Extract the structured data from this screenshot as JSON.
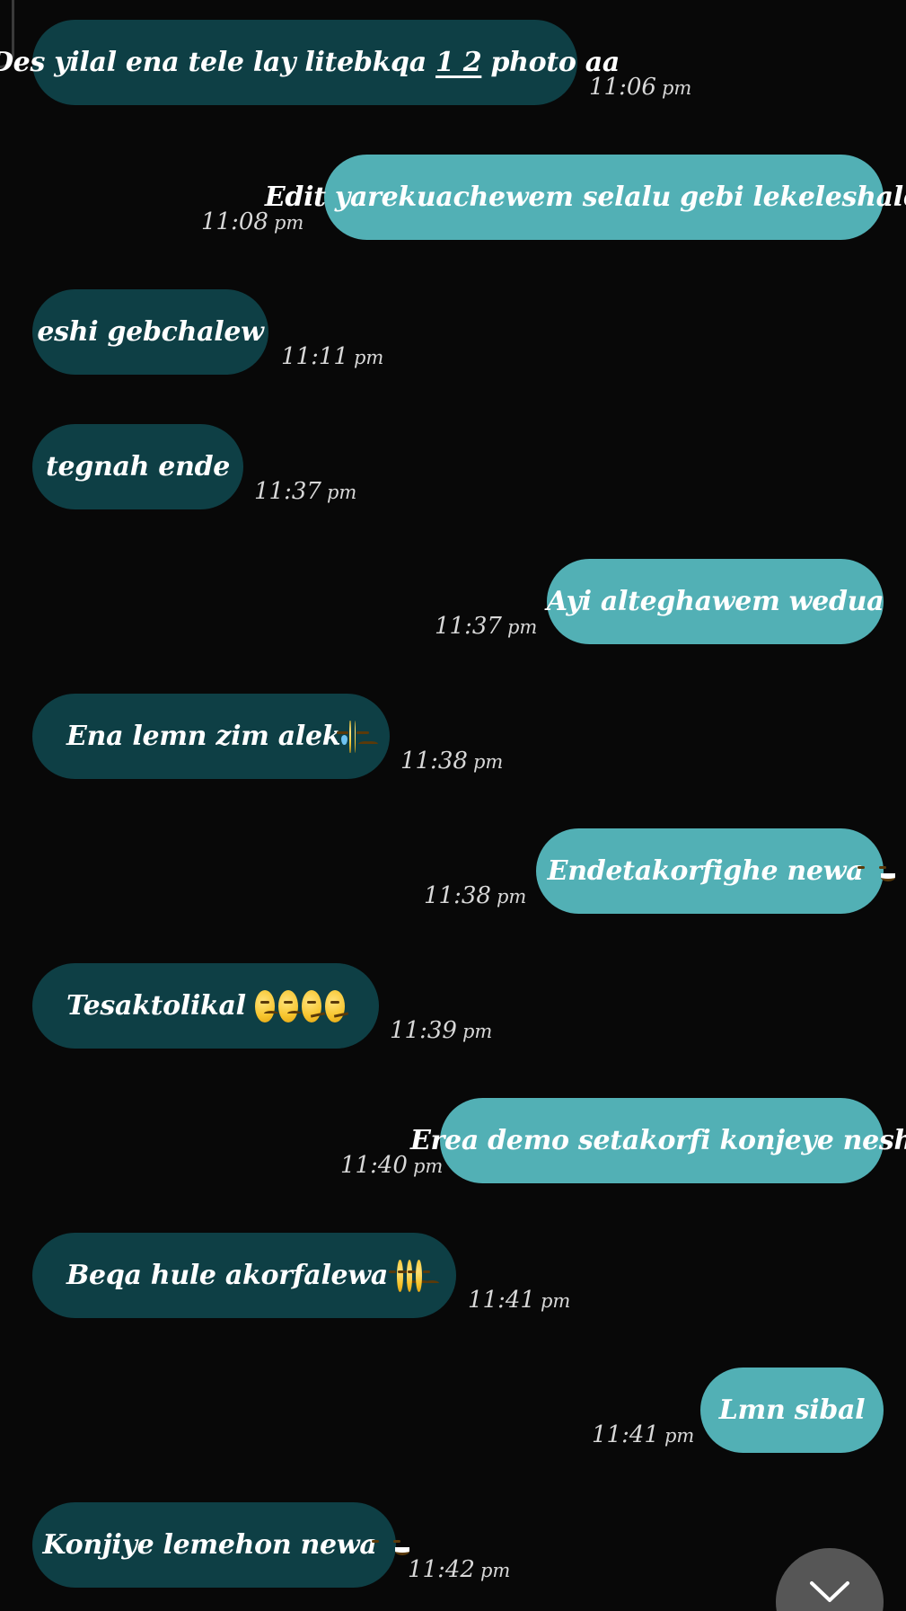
{
  "messages": [
    {
      "id": 1,
      "direction": "received",
      "text_before": "Des yilal ena tele lay litebkqa ",
      "text_underlined": "1 2",
      "text_after": " photo aa",
      "time": "11:06",
      "ampm": "pm"
    },
    {
      "id": 2,
      "direction": "sent",
      "text": "Edit yarekuachewem selalu gebi lekeleshalew",
      "time": "11:08",
      "ampm": "pm"
    },
    {
      "id": 3,
      "direction": "received",
      "text": "eshi gebchalew",
      "time": "11:11",
      "ampm": "pm"
    },
    {
      "id": 4,
      "direction": "received",
      "text": "tegnah ende",
      "time": "11:37",
      "ampm": "pm"
    },
    {
      "id": 5,
      "direction": "sent",
      "text": "Ayi alteghawem wedua",
      "time": "11:37",
      "ampm": "pm"
    },
    {
      "id": 6,
      "direction": "received",
      "text": "Ena lemn zim alek",
      "emojis": [
        "sad-tear-emoji",
        "disappointed-emoji"
      ],
      "time": "11:38",
      "ampm": "pm"
    },
    {
      "id": 7,
      "direction": "sent",
      "text": "Endetakorfighe newa",
      "emojis": [
        "laughing-emoji"
      ],
      "time": "11:38",
      "ampm": "pm"
    },
    {
      "id": 8,
      "direction": "received",
      "text": "Tesaktolikal",
      "emojis": [
        "disappointed-emoji",
        "disappointed-emoji",
        "confused-emoji",
        "confused-emoji"
      ],
      "time": "11:39",
      "ampm": "pm"
    },
    {
      "id": 9,
      "direction": "sent",
      "text": "Erea demo setakorfi konjeye nesh",
      "time": "11:40",
      "ampm": "pm"
    },
    {
      "id": 10,
      "direction": "received",
      "text": "Beqa hule akorfalewa",
      "emojis": [
        "disappointed-emoji",
        "disappointed-emoji",
        "disappointed-emoji"
      ],
      "time": "11:41",
      "ampm": "pm"
    },
    {
      "id": 11,
      "direction": "sent",
      "text": "Lmn sibal",
      "time": "11:41",
      "ampm": "pm"
    },
    {
      "id": 12,
      "direction": "received",
      "text": "Konjiye lemehon newa",
      "emojis": [
        "grinning-emoji"
      ],
      "time": "11:42",
      "ampm": "pm"
    }
  ],
  "colors": {
    "background": "#080808",
    "received_bubble": "#0e3f45",
    "sent_bubble": "#52b0b5",
    "text": "#ffffff",
    "timestamp": "#d8d8d8",
    "scroll_button": "#565656"
  },
  "scroll_button": {
    "icon": "chevron-down-icon"
  }
}
